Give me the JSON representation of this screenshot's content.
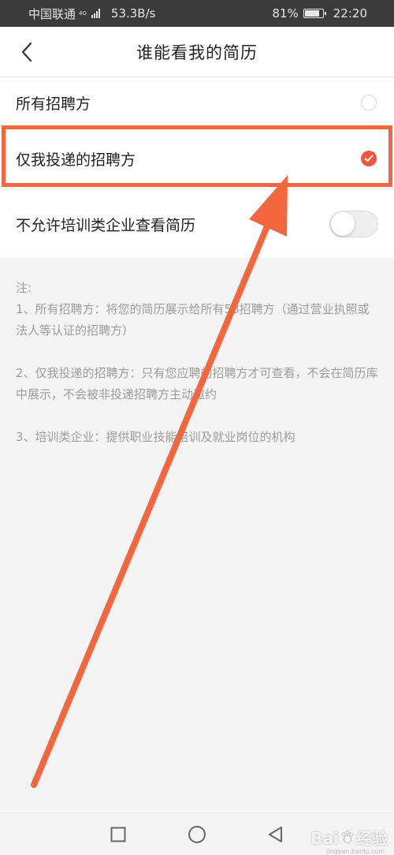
{
  "status_bar": {
    "carrier": "中国联通",
    "network_type": "4G",
    "speed": "53.3B/s",
    "battery": "81%",
    "battery_level": 0.81,
    "time": "22:20"
  },
  "header": {
    "title": "谁能看我的简历"
  },
  "options": [
    {
      "label": "所有招聘方",
      "selected": false
    },
    {
      "label": "仅我投递的招聘方",
      "selected": true
    },
    {
      "label": "不允许培训类企业查看简历",
      "toggle_on": false
    }
  ],
  "notes": {
    "heading": "注:",
    "items": [
      "1、所有招聘方：将您的简历展示给所有58招聘方（通过营业执照或法人等认证的招聘方）",
      "2、仅我投递的招聘方：只有您应聘的招聘方才可查看，不会在简历库中展示，不会被非投递招聘方主动邀约",
      "3、培训类企业：提供职业技能培训及就业岗位的机构"
    ]
  },
  "watermark": {
    "brand": "Bai",
    "brand2": "经验",
    "sub": "jingyan.baidu.com"
  },
  "colors": {
    "accent": "#f0573a",
    "annotation": "#f3673f"
  }
}
